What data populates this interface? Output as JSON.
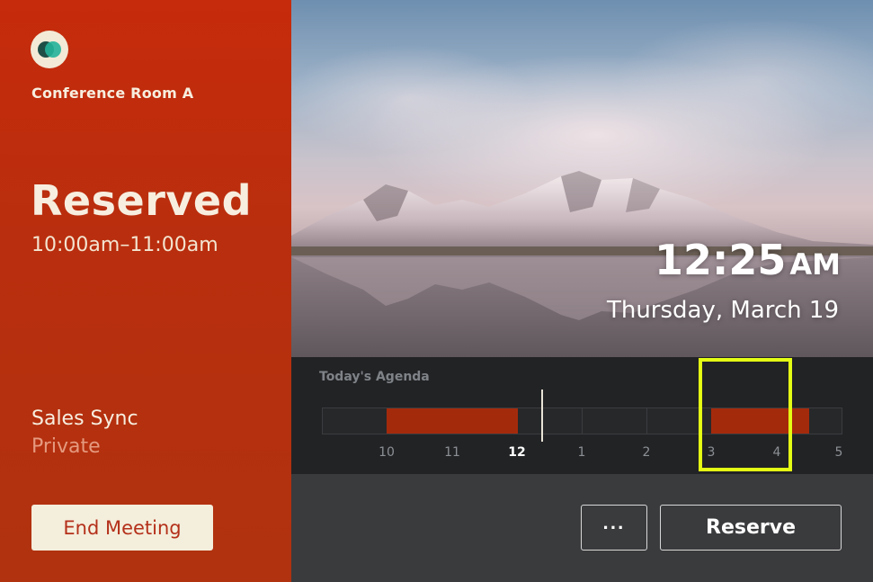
{
  "room": {
    "name": "Conference Room A"
  },
  "status": {
    "label": "Reserved",
    "time_range": "10:00am–11:00am"
  },
  "meeting": {
    "title": "Sales Sync",
    "privacy": "Private"
  },
  "actions": {
    "end_meeting": "End Meeting",
    "more": "···",
    "reserve": "Reserve"
  },
  "clock": {
    "time": "12:25",
    "ampm": "AM",
    "date": "Thursday, March 19"
  },
  "agenda": {
    "title": "Today's Agenda",
    "ticks": [
      "10",
      "11",
      "12",
      "1",
      "2",
      "3",
      "4",
      "5"
    ],
    "current_tick": "12"
  },
  "colors": {
    "accent": "#c0300f",
    "highlight": "#e4ff14",
    "agenda_block": "#a42a0c"
  }
}
